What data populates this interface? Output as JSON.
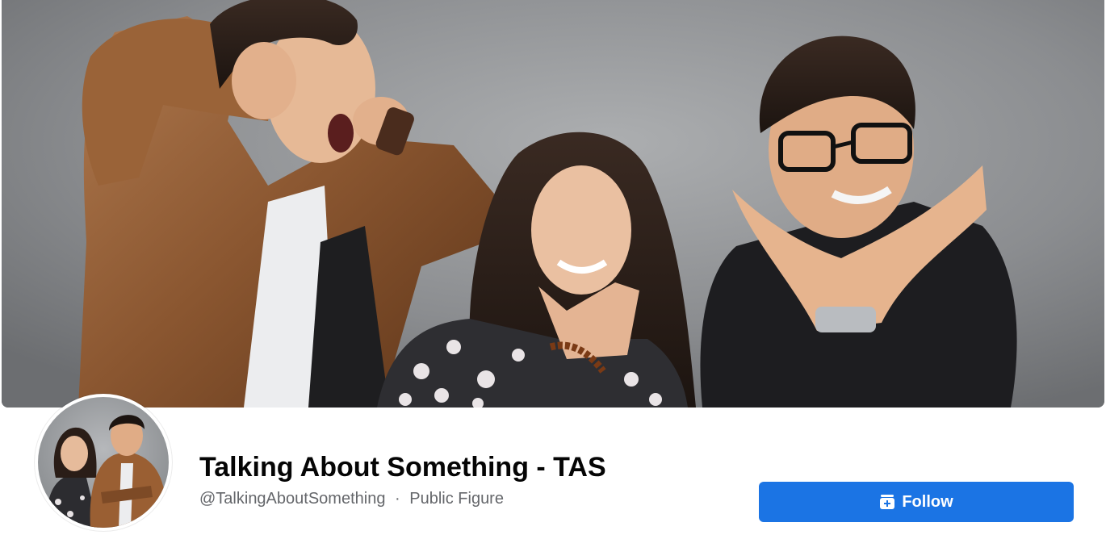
{
  "page": {
    "name": "Talking About Something - TAS",
    "handle": "@TalkingAboutSomething",
    "separator": "·",
    "category": "Public Figure"
  },
  "actions": {
    "follow_label": "Follow",
    "follow_icon": "follow-page-icon"
  },
  "colors": {
    "primary_button": "#1b74e4",
    "meta_text": "#65676b",
    "title_text": "#050505"
  }
}
